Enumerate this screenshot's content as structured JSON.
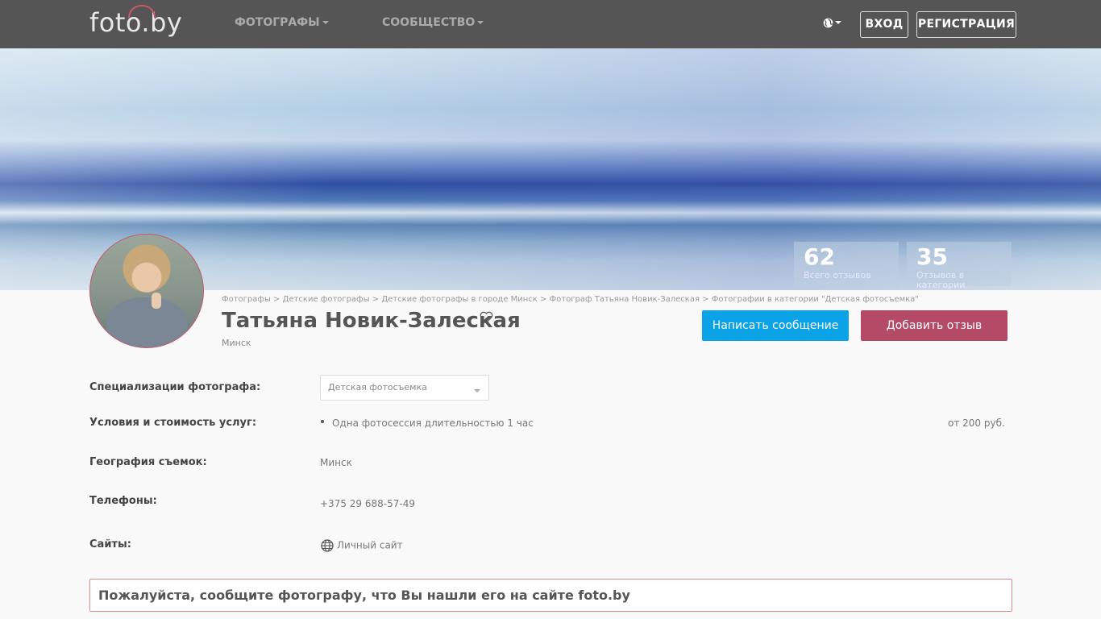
{
  "navbar": {
    "logo_text": "foto.by",
    "menu": [
      {
        "label": "ФОТОГРАФЫ"
      },
      {
        "label": "СООБЩЕСТВО"
      }
    ],
    "login_label": "ВХОД",
    "register_label": "РЕГИСТРАЦИЯ"
  },
  "stats": [
    {
      "value": "62",
      "label": "Всего отзывов"
    },
    {
      "value": "35",
      "label": "Отзывов в категории"
    }
  ],
  "breadcrumb": [
    "Фотографы",
    "Детские фотографы",
    "Детские фотографы в городе Минск",
    "Фотограф Татьяна Новик-Залеская",
    "Фотографии в категории \"Детская фотосъемка\""
  ],
  "breadcrumb_separator": ">",
  "profile": {
    "name": "Татьяна Новик-Залеская",
    "city": "Минск",
    "message_button": "Написать сообщение",
    "review_button": "Добавить отзыв"
  },
  "details": {
    "specializations_label": "Специализации фотографа:",
    "specialization_selected": "Детская фотосъемка",
    "services_label": "Условия и стоимость услуг:",
    "service_item": "Одна фотосессия длительностью 1 час",
    "service_price": "от 200 руб.",
    "geography_label": "География съемок:",
    "geography_value": "Минск",
    "phones_label": "Телефоны:",
    "phone_value": "+375 29 688-57-49",
    "sites_label": "Сайты:",
    "site_link": "Личный сайт"
  },
  "notice": "Пожалуйста, сообщите фотографу, что Вы нашли его на сайте foto.by",
  "colors": {
    "navbar_bg": "#555555",
    "message_button": "#0aa3e8",
    "review_button": "#b44a66",
    "notice_border": "#e08a90"
  }
}
